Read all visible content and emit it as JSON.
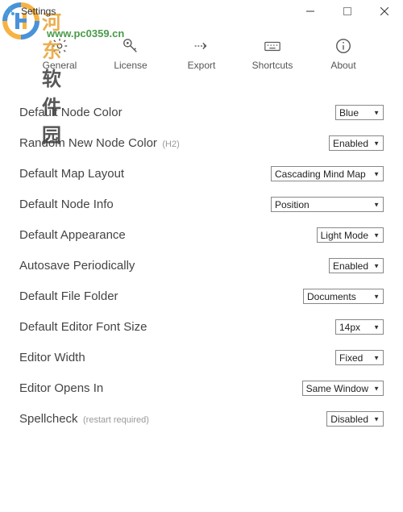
{
  "window": {
    "title": "Settings"
  },
  "watermark": {
    "line1a": "河东",
    "line1b": "软件园",
    "line2": "www.pc0359.cn"
  },
  "tabs": {
    "general": "General",
    "license": "License",
    "export": "Export",
    "shortcuts": "Shortcuts",
    "about": "About"
  },
  "settings": [
    {
      "label": "Default Node Color",
      "hint": "",
      "value": "Blue",
      "width": ""
    },
    {
      "label": "Random New Node Color",
      "hint": "(H2)",
      "value": "Enabled",
      "width": ""
    },
    {
      "label": "Default Map Layout",
      "hint": "",
      "value": "Cascading Mind Map",
      "width": "w120"
    },
    {
      "label": "Default Node Info",
      "hint": "",
      "value": "Position",
      "width": "w120"
    },
    {
      "label": "Default Appearance",
      "hint": "",
      "value": "Light Mode",
      "width": ""
    },
    {
      "label": "Autosave Periodically",
      "hint": "",
      "value": "Enabled",
      "width": ""
    },
    {
      "label": "Default File Folder",
      "hint": "",
      "value": "Documents",
      "width": "w90"
    },
    {
      "label": "Default Editor Font Size",
      "hint": "",
      "value": "14px",
      "width": ""
    },
    {
      "label": "Editor Width",
      "hint": "",
      "value": "Fixed",
      "width": ""
    },
    {
      "label": "Editor Opens In",
      "hint": "",
      "value": "Same Window",
      "width": ""
    },
    {
      "label": "Spellcheck",
      "hint": "(restart required)",
      "value": "Disabled",
      "width": ""
    }
  ]
}
